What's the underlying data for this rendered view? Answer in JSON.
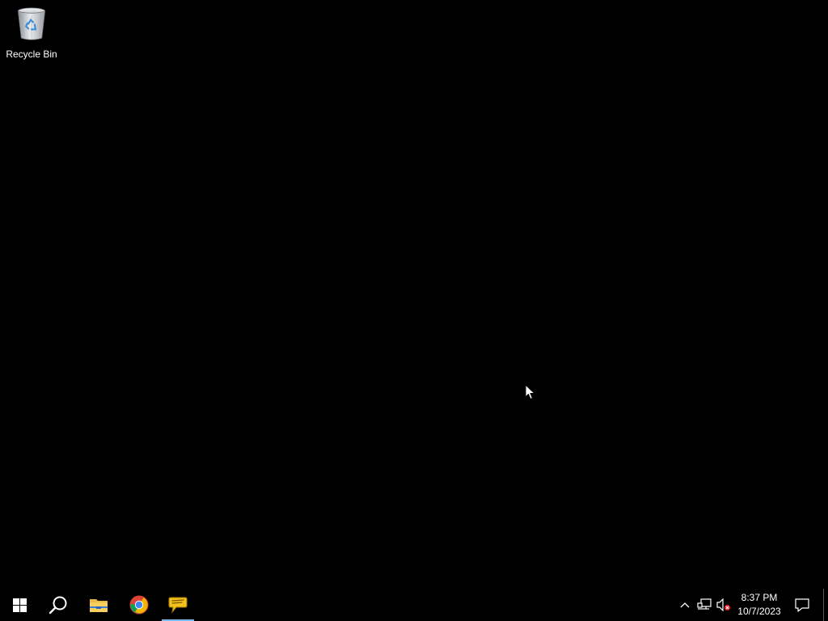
{
  "desktop": {
    "background_color": "#000000",
    "icons": [
      {
        "label": "Recycle Bin",
        "icon": "recycle-bin-icon"
      }
    ]
  },
  "taskbar": {
    "background_color": "#000000",
    "buttons": [
      {
        "name": "start-button",
        "icon": "windows-logo-icon"
      },
      {
        "name": "search-button",
        "icon": "search-icon"
      },
      {
        "name": "file-explorer-button",
        "icon": "folder-icon"
      },
      {
        "name": "chrome-button",
        "icon": "chrome-icon"
      },
      {
        "name": "chat-app-button",
        "icon": "speech-bubble-icon",
        "active": true
      }
    ],
    "tray": {
      "icons": [
        "chevron-up-icon",
        "network-icon",
        "volume-muted-icon"
      ],
      "time": "8:37 PM",
      "date": "10/7/2023",
      "notification_icon": "action-center-icon"
    },
    "accent_color": "#76b9ed"
  }
}
